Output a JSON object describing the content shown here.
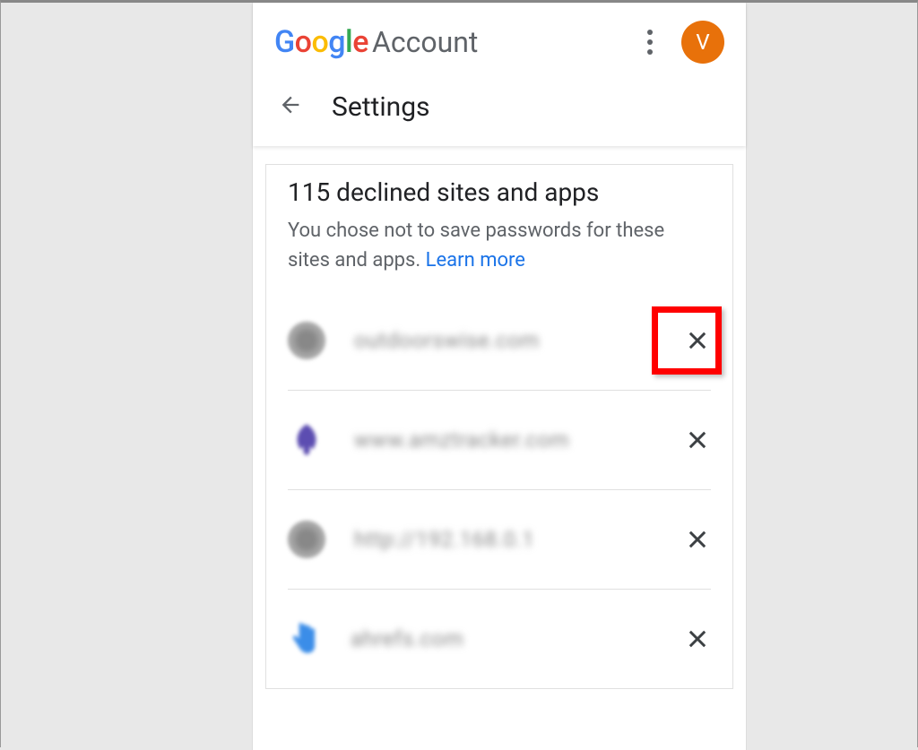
{
  "header": {
    "logo_prefix": "Google",
    "logo_suffix": "Account",
    "avatar_initial": "V",
    "settings_label": "Settings"
  },
  "section": {
    "title": "115 declined sites and apps",
    "description": "You chose not to save passwords for these sites and apps.",
    "learn_more_label": "Learn more"
  },
  "sites": [
    {
      "name": "outdoorswise.com",
      "icon": "globe",
      "highlighted": true
    },
    {
      "name": "www.amztracker.com",
      "icon": "rocket",
      "highlighted": false
    },
    {
      "name": "http://192.168.0.1",
      "icon": "globe",
      "highlighted": false
    },
    {
      "name": "ahrefs.com",
      "icon": "hand",
      "highlighted": false
    }
  ],
  "colors": {
    "highlight": "#FF0000",
    "link": "#1a73e8",
    "avatar_bg": "#E8710A"
  }
}
